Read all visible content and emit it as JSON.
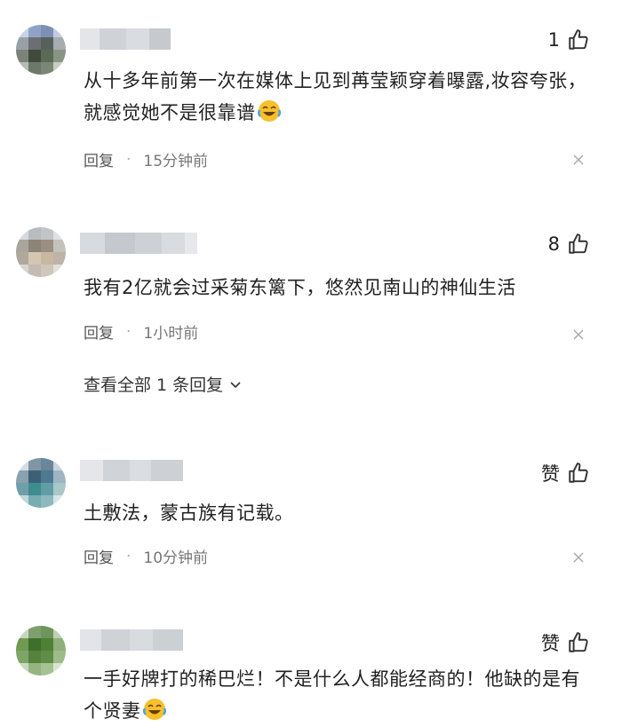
{
  "comments": [
    {
      "like_label": "1",
      "text": "从十多年前第一次在媒体上见到苒莹颖穿着曝露,妆容夸张，就感觉她不是很靠谱",
      "reply_label": "回复",
      "dot": "·",
      "time": "15分钟前"
    },
    {
      "like_label": "8",
      "text": "我有2亿就会过采菊东篱下，悠然见南山的神仙生活",
      "reply_label": "回复",
      "dot": "·",
      "time": "1小时前",
      "view_replies": "查看全部 1 条回复"
    },
    {
      "like_label": "赞",
      "text": "土敷法，蒙古族有记载。",
      "reply_label": "回复",
      "dot": "·",
      "time": "10分钟前"
    },
    {
      "like_label": "赞",
      "text": "一手好牌打的稀巴烂！不是什么人都能经商的！他缺的是有个贤妻"
    }
  ],
  "icons": {
    "like": "thumbs-up-icon",
    "close": "close-icon",
    "chevron": "chevron-down-icon",
    "emoji": "laughing-crying-emoji"
  },
  "colors": {
    "text": "#222222",
    "meta": "#777777",
    "divider": "#aaaaaa"
  }
}
